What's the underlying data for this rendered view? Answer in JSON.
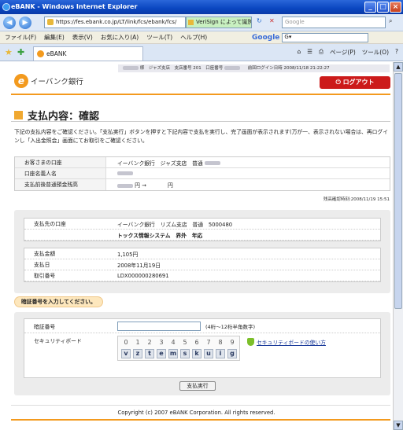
{
  "window": {
    "title": "eBANK - Windows Internet Explorer",
    "minimize": "_",
    "maximize": "□",
    "close": "×"
  },
  "address": {
    "url": "https://fes.ebank.co.jp/LT/link/fcs/ebank/fcs/",
    "verisign": "VeriSign によって識別",
    "search_placeholder": "Google"
  },
  "menu": {
    "items": [
      "ファイル(F)",
      "編集(E)",
      "表示(V)",
      "お気に入り(A)",
      "ツール(T)",
      "ヘルプ(H)"
    ],
    "google_label": "Google",
    "google_input": "G▾"
  },
  "tab": {
    "label": "eBANK"
  },
  "toolbar": {
    "page": "ページ(P)",
    "tools": "ツール(O)"
  },
  "header": {
    "info_suffix": "様　ジャズ支店　支店番号 201　口座番号",
    "last_login": "前回ログイン日時 2008/11/18 21:22:27",
    "logo": "イーバンク銀行",
    "logout": "ログアウト"
  },
  "page_title": "支払内容：確認",
  "instruction": "下記の支払内容をご確認ください。「支払実行」ボタンを押すと下記内容で支払を実行し、完了画面が表示されます(万が一、表示されない場合は、再ログインし「入出金照会」画面にてお取引をご確認ください。",
  "account": [
    {
      "label": "お客さまの口座",
      "value": "イーバンク銀行　ジャズ支店　普通"
    },
    {
      "label": "口座名義人名",
      "value": ""
    },
    {
      "label": "支払前後普通預金残高",
      "value": "円 →　　　　円"
    }
  ],
  "balance_stamp": "残高確認時刻:2008/11/19 15:51",
  "payee": [
    {
      "label": "支払先の口座",
      "value": "イーバンク銀行　リズム支店　普通　5000480"
    },
    {
      "label": "",
      "value": "トックス情報システム　界外　年応"
    }
  ],
  "payment": [
    {
      "label": "支払金額",
      "value": "1,105円"
    },
    {
      "label": "支払日",
      "value": "2008年11月19日"
    },
    {
      "label": "取引番号",
      "value": "LDX000000280691"
    }
  ],
  "pin": {
    "bubble": "暗証番号を入力してください。",
    "label": "暗証番号",
    "hint": "(4桁〜12桁半角数字)",
    "security_label": "セキュリティボード",
    "digits": [
      "0",
      "1",
      "2",
      "3",
      "4",
      "5",
      "6",
      "7",
      "8",
      "9"
    ],
    "letters": [
      "v",
      "z",
      "t",
      "e",
      "m",
      "s",
      "k",
      "u",
      "i",
      "g"
    ],
    "help_link": "セキュリティボードの使い方"
  },
  "execute_button": "支払実行",
  "copyright": "Copyright (c) 2007 eBANK Corporation. All rights reserved."
}
